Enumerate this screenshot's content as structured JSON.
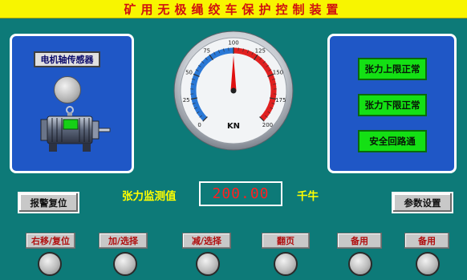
{
  "title": "矿用无极绳绞车保护控制装置",
  "sensor": {
    "label": "电机轴传感器"
  },
  "gauge": {
    "ticks": [
      "0",
      "25",
      "50",
      "75",
      "100",
      "125",
      "150",
      "175",
      "200"
    ],
    "unit": "KN",
    "value": 100,
    "min": 0,
    "max": 200,
    "colors": {
      "low": "#2a78d6",
      "high": "#e02020",
      "needle": "#e01010"
    }
  },
  "status": {
    "upper": "张力上限正常",
    "lower": "张力下限正常",
    "safety": "安全回路通"
  },
  "tension": {
    "label": "张力监测值",
    "value": "200.00",
    "unit": "千牛"
  },
  "buttons": {
    "alarm_reset": "报警复位",
    "params": "参数设置"
  },
  "func_buttons": [
    "右移/复位",
    "加/选择",
    "减/选择",
    "翻页",
    "备用",
    "备用"
  ],
  "colors": {
    "background": "#0d7a78",
    "title_bg": "#f8f500",
    "title_fg": "#d01010",
    "panel": "#1f57c6",
    "status_on": "#14e014"
  }
}
